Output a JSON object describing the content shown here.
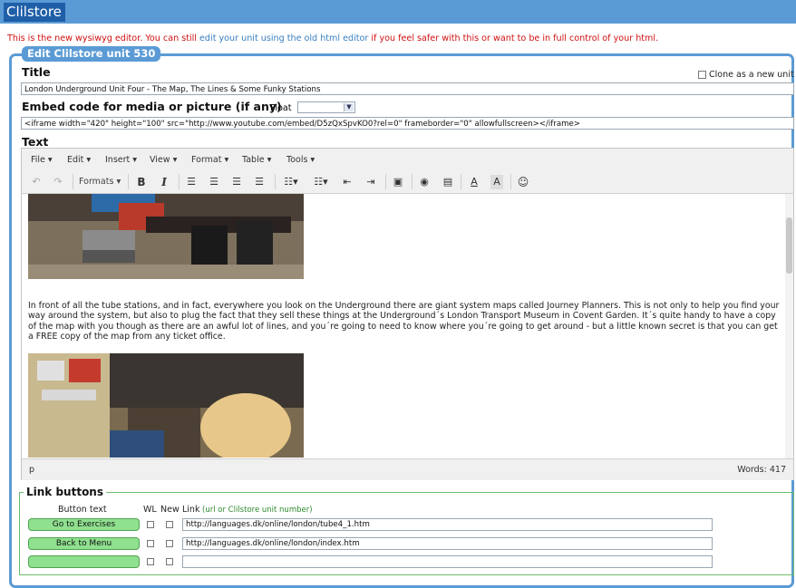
{
  "app": {
    "brand": "Clilstore"
  },
  "notice": {
    "before": "This is the new wysiwyg editor.  You can still ",
    "link": "edit your unit using the old html editor",
    "after": " if you feel safer with this or want to be in full control of your html."
  },
  "form": {
    "legend": "Edit Clilstore unit 530",
    "title_label": "Title",
    "clone_label": "Clone as a new unit",
    "title_value": "London Underground Unit Four - The Map, The Lines & Some Funky Stations",
    "embed_label": "Embed code for media or picture (if any)",
    "float_label": "Float",
    "float_value": "",
    "embed_value": "<iframe width=\"420\" height=\"100\" src=\"http://www.youtube.com/embed/D5zQxSpvKO0?rel=0\" frameborder=\"0\" allowfullscreen></iframe>",
    "text_label": "Text"
  },
  "editor": {
    "menus": [
      "File ▾",
      "Edit ▾",
      "Insert ▾",
      "View ▾",
      "Format ▾",
      "Table ▾",
      "Tools ▾"
    ],
    "formats_label": "Formats ▾",
    "paragraph": "In front of all the tube stations, and in fact, everywhere you look on the Underground there are giant system maps called Journey Planners. This is not only to help you find your way around the system, but also to plug the fact that they sell these things at the Underground´s London Transport Museum in Covent Garden. It´s quite handy to have a copy of the map with you though as there are an awful lot of lines, and you´re going to need to know where you´re going to get around - but a little known secret is that you can get a FREE copy of the map from any ticket office.",
    "status_path": "p",
    "word_count": "Words: 417"
  },
  "links": {
    "legend": "Link buttons",
    "col_button_text": "Button text",
    "col_wl": "WL",
    "col_new": "New",
    "col_link": "Link",
    "col_link_hint": "(url or Clilstore unit number)",
    "rows": [
      {
        "label": "Go to Exercises",
        "url": "http://languages.dk/online/london/tube4_1.htm"
      },
      {
        "label": "Back to Menu",
        "url": "http://languages.dk/online/london/index.htm"
      },
      {
        "label": "",
        "url": ""
      }
    ]
  }
}
